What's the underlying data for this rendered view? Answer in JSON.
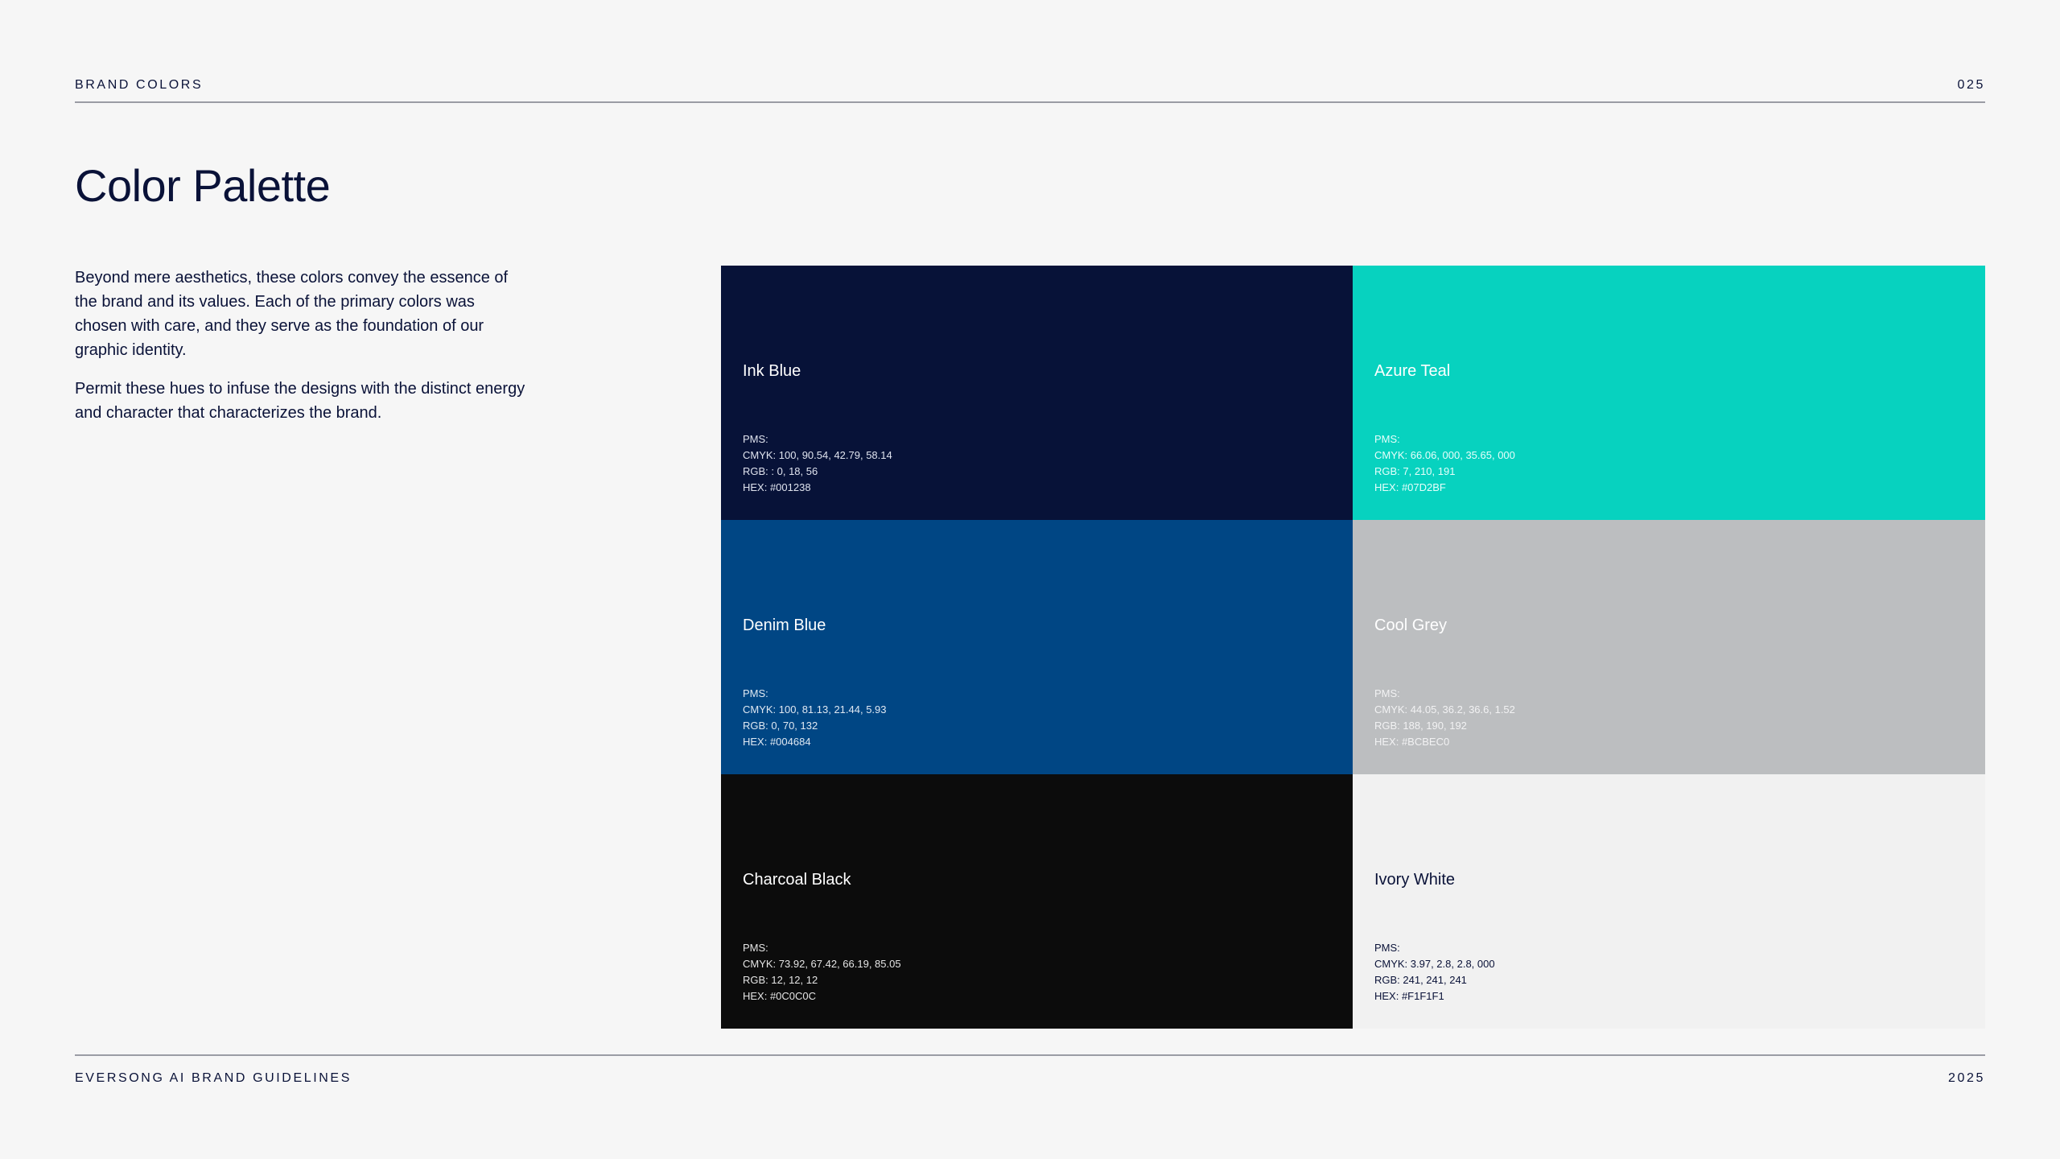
{
  "header": {
    "section": "BRAND COLORS",
    "page_number": "025"
  },
  "title": "Color Palette",
  "intro": [
    "Beyond mere aesthetics, these colors convey the essence of the brand and its values. Each of the primary colors was chosen with care, and they serve as the foundation of our graphic identity.",
    "Permit these hues to infuse the designs with the distinct energy and character that characterizes the brand."
  ],
  "swatches": [
    {
      "name": "Ink Blue",
      "pms": "PMS:",
      "cmyk": "CMYK: 100, 90.54, 42.79, 58.14",
      "rgb": "RGB: : 0, 18, 56",
      "hex": "HEX: #001238",
      "fill": "#071238",
      "text_color": "#ffffff",
      "spec_color": "#dfe3ee"
    },
    {
      "name": "Azure Teal",
      "pms": "PMS:",
      "cmyk": "CMYK: 66.06, 000, 35.65, 000",
      "rgb": "RGB: 7, 210, 191",
      "hex": "HEX: #07D2BF",
      "fill": "#07d2bf",
      "text_color": "#ffffff",
      "spec_color": "#e6fffb"
    },
    {
      "name": "Denim Blue",
      "pms": "PMS:",
      "cmyk": "CMYK: 100, 81.13, 21.44, 5.93",
      "rgb": "RGB: 0, 70, 132",
      "hex": "HEX: #004684",
      "fill": "#004684",
      "text_color": "#ffffff",
      "spec_color": "#dfe8f2"
    },
    {
      "name": "Cool Grey",
      "pms": "PMS:",
      "cmyk": "CMYK: 44.05, 36.2, 36.6, 1.52",
      "rgb": "RGB: 188, 190, 192",
      "hex": "HEX: #BCBEC0",
      "fill": "#bcbec0",
      "text_color": "#ffffff",
      "spec_color": "#f2f2f3"
    },
    {
      "name": "Charcoal Black",
      "pms": "PMS:",
      "cmyk": "CMYK: 73.92, 67.42, 66.19, 85.05",
      "rgb": "RGB: 12, 12, 12",
      "hex": "HEX: #0C0C0C",
      "fill": "#0c0c0c",
      "text_color": "#ffffff",
      "spec_color": "#e4e4e4"
    },
    {
      "name": "Ivory White",
      "pms": "PMS:",
      "cmyk": "CMYK: 3.97, 2.8, 2.8, 000",
      "rgb": "RGB: 241, 241, 241",
      "hex": "HEX: #F1F1F1",
      "fill": "#f1f1f1",
      "text_color": "#0a1238",
      "spec_color": "#0a1238"
    }
  ],
  "footer": {
    "brand": "EVERSONG AI BRAND GUIDELINES",
    "year": "2025"
  }
}
